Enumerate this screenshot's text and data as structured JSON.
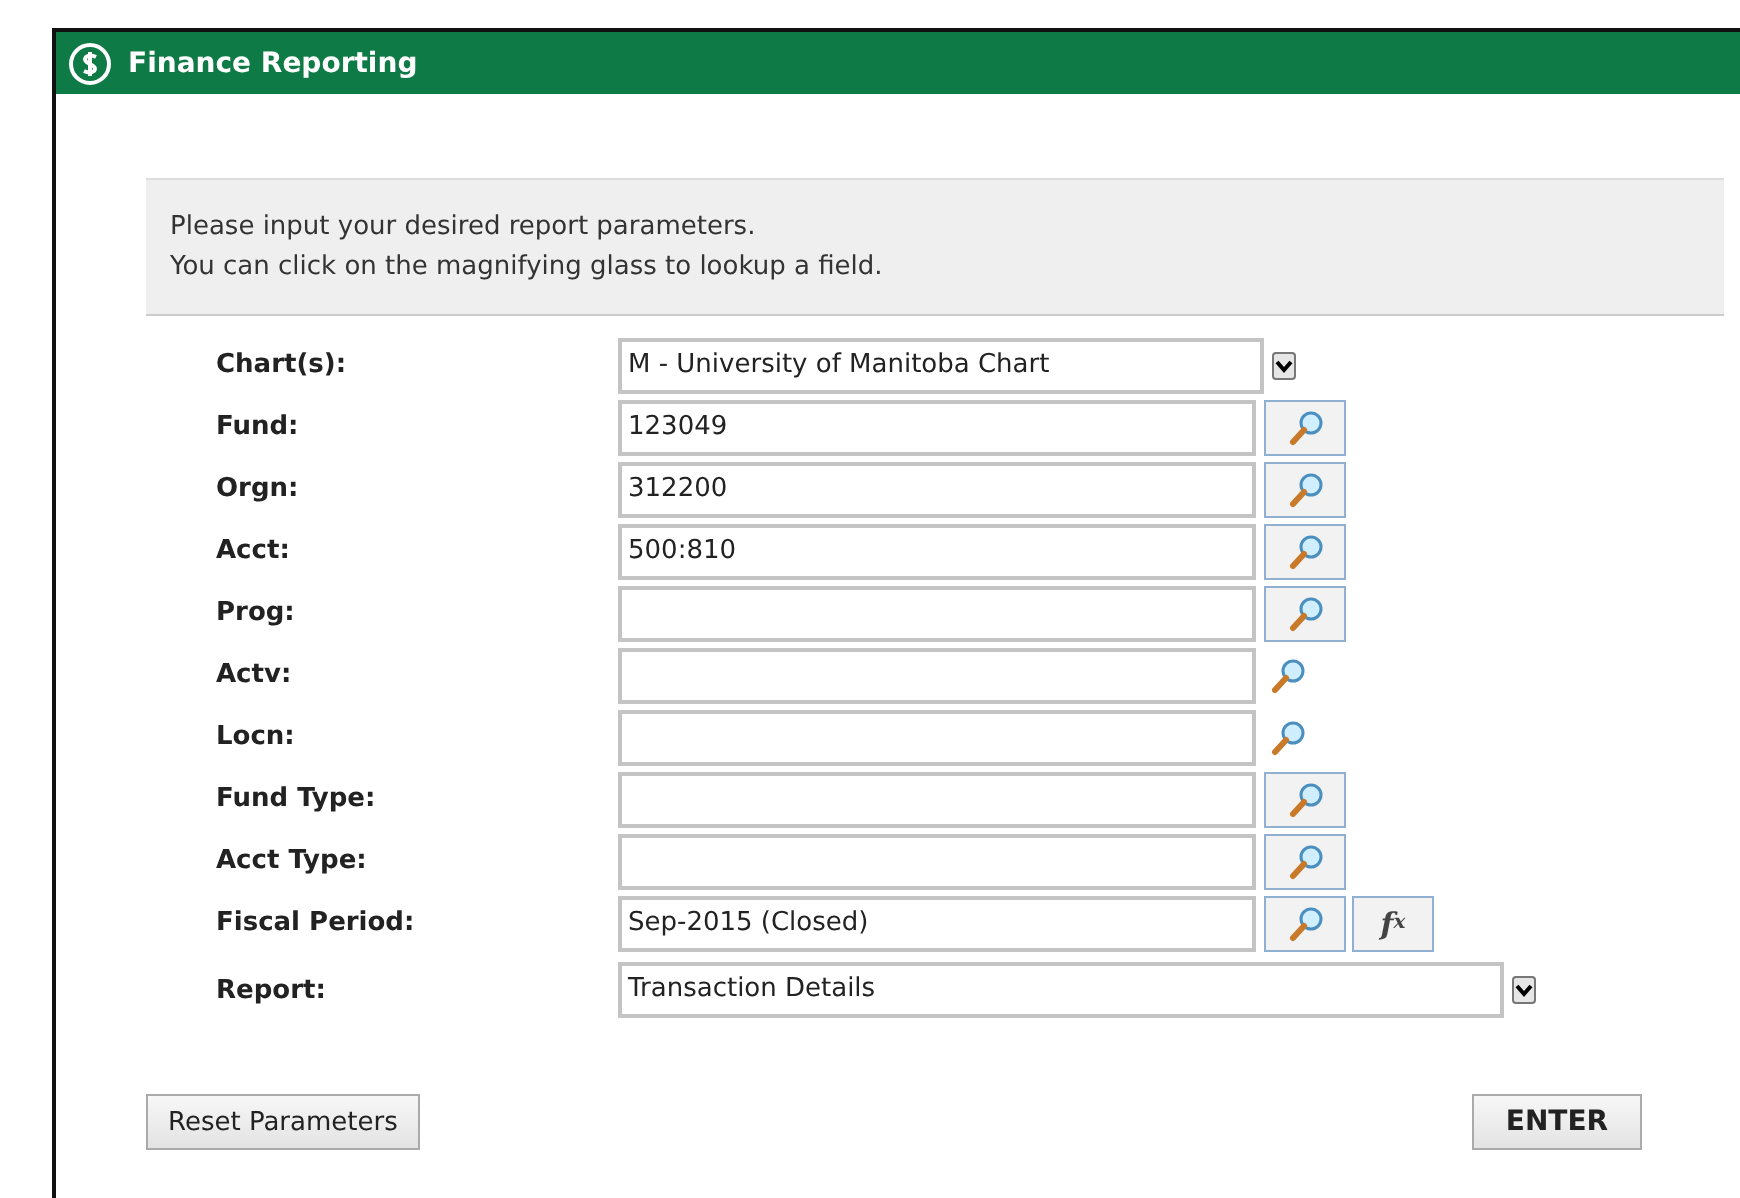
{
  "window": {
    "title": "Finance Reporting"
  },
  "instructions": [
    "Please input your desired report parameters.",
    "You can click on the magnifying glass to lookup a field."
  ],
  "fields": [
    {
      "label": "Chart(s):",
      "kind": "dropdown",
      "value": "M - University of Manitoba Chart"
    },
    {
      "label": "Fund:",
      "kind": "lookup",
      "value": "123049",
      "framed": true
    },
    {
      "label": "Orgn:",
      "kind": "lookup",
      "value": "312200",
      "framed": true
    },
    {
      "label": "Acct:",
      "kind": "lookup",
      "value": "500:810",
      "framed": true
    },
    {
      "label": "Prog:",
      "kind": "lookup",
      "framed": true
    },
    {
      "label": "Actv:",
      "kind": "lookup",
      "framed": false
    },
    {
      "label": "Locn:",
      "kind": "lookup",
      "framed": false
    },
    {
      "label": "Fund Type:",
      "kind": "lookup",
      "framed": true
    },
    {
      "label": "Acct Type:",
      "kind": "lookup",
      "framed": true
    },
    {
      "label": "Fiscal Period:",
      "kind": "lookup",
      "value": "Sep-2015 (Closed)",
      "framed": true,
      "formula_button": {
        "f": "f",
        "x": "x"
      }
    },
    {
      "label": "Report:",
      "kind": "wide-dropdown",
      "value": "Transaction Details"
    }
  ],
  "buttons": {
    "reset": "Reset Parameters",
    "enter": "ENTER"
  }
}
